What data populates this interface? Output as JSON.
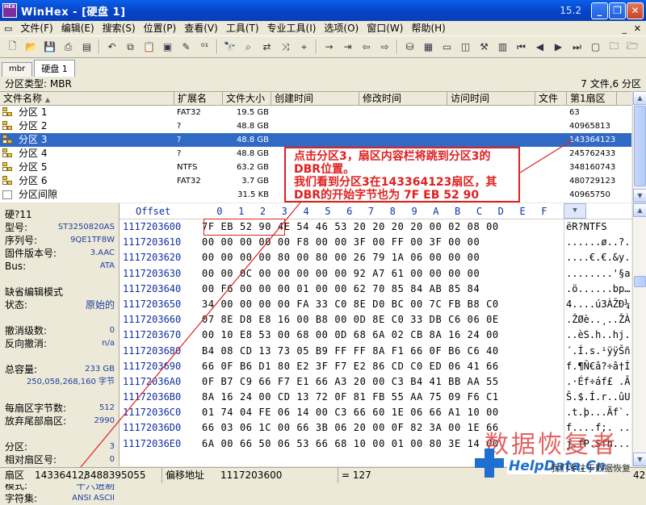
{
  "window": {
    "title": "WinHex - [硬盘 1]",
    "version": "15.2",
    "app_icon_text": "HEX"
  },
  "menu": [
    "文件(F)",
    "编辑(E)",
    "搜索(S)",
    "位置(P)",
    "查看(V)",
    "工具(T)",
    "专业工具(I)",
    "选项(O)",
    "窗口(W)",
    "帮助(H)"
  ],
  "tabs": [
    "mbr",
    "硬盘 1"
  ],
  "partition_header": {
    "label": "分区类型: MBR",
    "summary": "7 文件,6 分区"
  },
  "columns": [
    "文件名称",
    "扩展名",
    "文件大小",
    "创建时间",
    "修改时间",
    "访问时间",
    "文件",
    "第1扇区"
  ],
  "partitions": [
    {
      "name": "分区 1",
      "ext": "FAT32",
      "size": "19.5 GB",
      "sector": "63"
    },
    {
      "name": "分区 2",
      "ext": "?",
      "size": "48.8 GB",
      "sector": "40965813"
    },
    {
      "name": "分区 3",
      "ext": "?",
      "size": "48.8 GB",
      "sector": "143364123"
    },
    {
      "name": "分区 4",
      "ext": "?",
      "size": "48.8 GB",
      "sector": "245762433"
    },
    {
      "name": "分区 5",
      "ext": "NTFS",
      "size": "63.2 GB",
      "sector": "348160743"
    },
    {
      "name": "分区 6",
      "ext": "FAT32",
      "size": "3.7 GB",
      "sector": "480729123"
    },
    {
      "name": "分区间隙",
      "ext": "",
      "size": "31.5 KB",
      "sector": "40965750"
    }
  ],
  "callout": {
    "line1": "点击分区3，扇区内容栏将跳到分区3的",
    "line2": "DBR位置。",
    "line3": "我们看到分区3在143364123扇区，其",
    "line4": "DBR的开始字节也为 7F EB 52 90"
  },
  "info_panel": [
    {
      "label": "硬?11",
      "value": ""
    },
    {
      "label": "型号:",
      "value": "ST3250820AS"
    },
    {
      "label": "序列号:",
      "value": "9QE1TF8W"
    },
    {
      "label": "固件版本号:",
      "value": "3.AAC"
    },
    {
      "label": "Bus:",
      "value": "ATA"
    },
    {
      "label": "",
      "value": ""
    },
    {
      "label": "缺省编辑模式",
      "value": ""
    },
    {
      "label": "状态:",
      "value": "原始的"
    },
    {
      "label": "",
      "value": ""
    },
    {
      "label": "撤消级数:",
      "value": "0"
    },
    {
      "label": "反向撤消:",
      "value": "n/a"
    },
    {
      "label": "",
      "value": ""
    },
    {
      "label": "总容量:",
      "value": "233 GB"
    },
    {
      "label": "",
      "value": "250,058,268,160 字节"
    },
    {
      "label": "",
      "value": ""
    },
    {
      "label": "每扇区字节数:",
      "value": "512"
    },
    {
      "label": "放弃尾部扇区:",
      "value": "2990"
    },
    {
      "label": "",
      "value": ""
    },
    {
      "label": "分区:",
      "value": "3"
    },
    {
      "label": "相对扇区号:",
      "value": "0"
    },
    {
      "label": "",
      "value": ""
    },
    {
      "label": "模式:",
      "value": "十六进制"
    },
    {
      "label": "字符集:",
      "value": "ANSI ASCII"
    }
  ],
  "hex": {
    "offset_label": "Offset",
    "col_headers": [
      "0",
      "1",
      "2",
      "3",
      "4",
      "5",
      "6",
      "7",
      "8",
      "9",
      "A",
      "B",
      "C",
      "D",
      "E",
      "F"
    ],
    "rows": [
      {
        "offset": "1117203600",
        "bytes": "7F EB 52 90 4E 54 46 53 20 20 20 20 00 02 08 00",
        "ascii": "ëR?NTFS"
      },
      {
        "offset": "1117203610",
        "bytes": "00 00 00 00 00 F8 00 00 3F 00 FF 00 3F 00 00",
        "ascii": "......ø..?.ÿ.?"
      },
      {
        "offset": "1117203620",
        "bytes": "00 00 00 00 80 00 80 00 26 79 1A 06 00 00 00",
        "ascii": "....€.€.&y.."
      },
      {
        "offset": "1117203630",
        "bytes": "00 00 0C 00 00 00 00 00 92 A7 61 00 00 00 00",
        "ascii": "........'§a.."
      },
      {
        "offset": "1117203640",
        "bytes": "00 F6 00 00 00 01 00 00 62 70 85 84 AB 85 84",
        "ascii": ".ö......bp…„«…"
      },
      {
        "offset": "1117203650",
        "bytes": "34 00 00 00 00 FA 33 C0 8E D0 BC 00 7C FB B8 C0",
        "ascii": "4....ú3ÀŽÐ¼.|û¸À"
      },
      {
        "offset": "1117203660",
        "bytes": "07 8E D8 E8 16 00 B8 00 0D 8E C0 33 DB C6 06 0E",
        "ascii": ".ŽØè..¸..ŽÀ3ÛÆ.."
      },
      {
        "offset": "1117203670",
        "bytes": "00 10 E8 53 00 68 00 0D 68 6A 02 CB 8A 16 24 00",
        "ascii": "..èS.h..hj.ËŠ.$."
      },
      {
        "offset": "1117203680",
        "bytes": "B4 08 CD 13 73 05 B9 FF FF 8A F1 66 0F B6 C6 40",
        "ascii": "´.Í.s.¹ÿÿŠñf.¶Æ@"
      },
      {
        "offset": "1117203690",
        "bytes": "66 0F B6 D1 80 E2 3F F7 E2 86 CD C0 ED 06 41 66",
        "ascii": "f.¶Ñ€â?÷â†ÍÀí.Af"
      },
      {
        "offset": "11172036A0",
        "bytes": "0F B7 C9 66 F7 E1 66 A3 20 00 C3 B4 41 BB AA 55",
        "ascii": ".·Éf÷áf£ .Ã´A»ªU"
      },
      {
        "offset": "11172036B0",
        "bytes": "8A 16 24 00 CD 13 72 0F 81 FB 55 AA 75 09 F6 C1",
        "ascii": "Š.$.Í.r..ûUªu.öÁ"
      },
      {
        "offset": "11172036C0",
        "bytes": "01 74 04 FE 06 14 00 C3 66 60 1E 06 66 A1 10 00",
        "ascii": ".t.þ...Ãf`..f¡.."
      },
      {
        "offset": "11172036D0",
        "bytes": "66 03 06 1C 00 66 3B 06 20 00 0F 82 3A 00 1E 66",
        "ascii": "f....f;. ..‚:..f"
      },
      {
        "offset": "11172036E0",
        "bytes": "6A 00 66 50 06 53 66 68 10 00 01 00 80 3E 14 00",
        "ascii": "j.fP.Sfh....€>.."
      }
    ]
  },
  "status": {
    "sector_label": "扇区",
    "sector_value": "143364123",
    "sector_total": "/ 488395055",
    "offset_label": "偏移地址",
    "offset_value": "1117203600",
    "eq": "= 127",
    "end": "42"
  },
  "watermark": {
    "chinese": "数据恢复者",
    "url": "HelpData.Cn",
    "slogan": "我们专注于数据恢复"
  }
}
